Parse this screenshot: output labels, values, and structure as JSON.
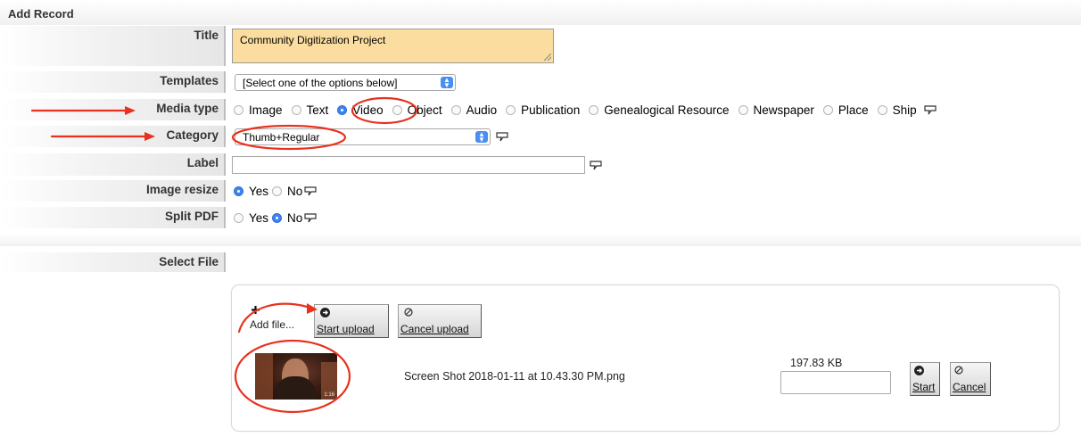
{
  "page": {
    "heading": "Add Record"
  },
  "form": {
    "title": {
      "label": "Title",
      "value": "Community Digitization Project"
    },
    "templates": {
      "label": "Templates",
      "selected": "[Select one of the options below]"
    },
    "media_type": {
      "label": "Media type",
      "options": [
        "Image",
        "Text",
        "Video",
        "Object",
        "Audio",
        "Publication",
        "Genealogical Resource",
        "Newspaper",
        "Place",
        "Ship"
      ],
      "selected": "Video"
    },
    "category": {
      "label": "Category",
      "selected": "Thumb+Regular"
    },
    "label_field": {
      "label": "Label",
      "value": ""
    },
    "image_resize": {
      "label": "Image resize",
      "options": [
        "Yes",
        "No"
      ],
      "selected": "Yes"
    },
    "split_pdf": {
      "label": "Split PDF",
      "options": [
        "Yes",
        "No"
      ],
      "selected": "No"
    },
    "select_file": {
      "label": "Select File"
    }
  },
  "uploader": {
    "add_file_label": "Add file...",
    "start_upload_label": "Start upload",
    "cancel_upload_label": "Cancel upload",
    "file": {
      "name": "Screen Shot 2018-01-11 at 10.43.30 PM.png",
      "size": "197.83 KB",
      "thumb_duration": "1:16",
      "start_label": "Start",
      "cancel_label": "Cancel"
    }
  },
  "colors": {
    "title_bg": "#fbde9f",
    "accent": "#3d84f0",
    "annotation": "#e8321e"
  }
}
